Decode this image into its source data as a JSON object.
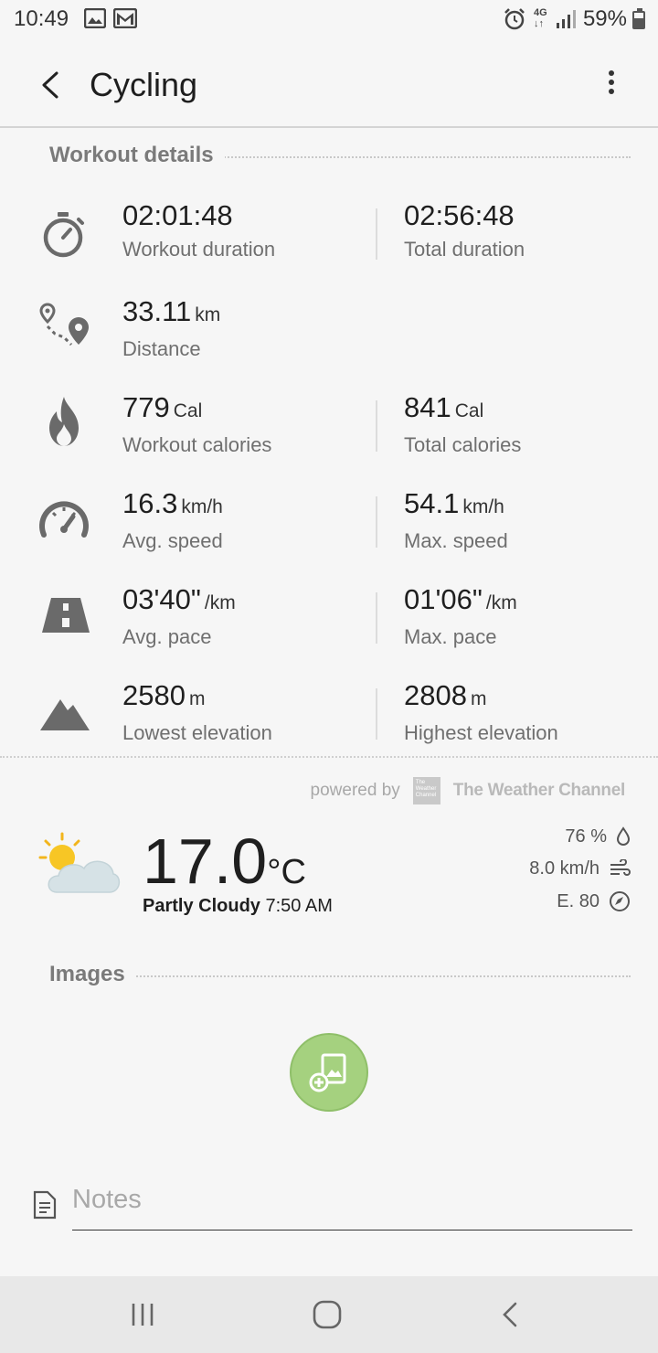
{
  "status_bar": {
    "time": "10:49",
    "battery": "59%",
    "network": "4G",
    "icons": [
      "image-icon",
      "gmail-icon",
      "alarm-icon",
      "network-4g-icon",
      "signal-icon",
      "battery-icon"
    ]
  },
  "app_bar": {
    "title": "Cycling"
  },
  "workout": {
    "section_title": "Workout details",
    "rows": [
      {
        "icon": "stopwatch-icon",
        "left": {
          "value": "02:01:48",
          "unit": "",
          "label": "Workout duration"
        },
        "right": {
          "value": "02:56:48",
          "unit": "",
          "label": "Total duration"
        }
      },
      {
        "icon": "route-icon",
        "left": {
          "value": "33.11",
          "unit": "km",
          "label": "Distance"
        }
      },
      {
        "icon": "flame-icon",
        "left": {
          "value": "779",
          "unit": "Cal",
          "label": "Workout calories"
        },
        "right": {
          "value": "841",
          "unit": "Cal",
          "label": "Total calories"
        }
      },
      {
        "icon": "speedometer-icon",
        "left": {
          "value": "16.3",
          "unit": "km/h",
          "label": "Avg. speed"
        },
        "right": {
          "value": "54.1",
          "unit": "km/h",
          "label": "Max. speed"
        }
      },
      {
        "icon": "road-icon",
        "left": {
          "value": "03'40\"",
          "unit": "/km",
          "label": "Avg. pace"
        },
        "right": {
          "value": "01'06\"",
          "unit": "/km",
          "label": "Max. pace"
        }
      },
      {
        "icon": "mountain-icon",
        "left": {
          "value": "2580",
          "unit": "m",
          "label": "Lowest elevation"
        },
        "right": {
          "value": "2808",
          "unit": "m",
          "label": "Highest elevation"
        }
      }
    ]
  },
  "weather": {
    "powered_by": "powered by",
    "provider": "The Weather Channel",
    "provider_logo_text": "The Weather Channel",
    "temperature": "17.0",
    "temperature_unit": "°C",
    "condition": "Partly Cloudy",
    "time": "7:50 AM",
    "humidity": "76 %",
    "wind_speed": "8.0 km/h",
    "wind_direction": "E. 80",
    "icon": "partly-cloudy-icon"
  },
  "images": {
    "section_title": "Images"
  },
  "notes": {
    "placeholder": "Notes"
  },
  "colors": {
    "accent_green": "#a5d17f",
    "background": "#f6f6f6"
  }
}
